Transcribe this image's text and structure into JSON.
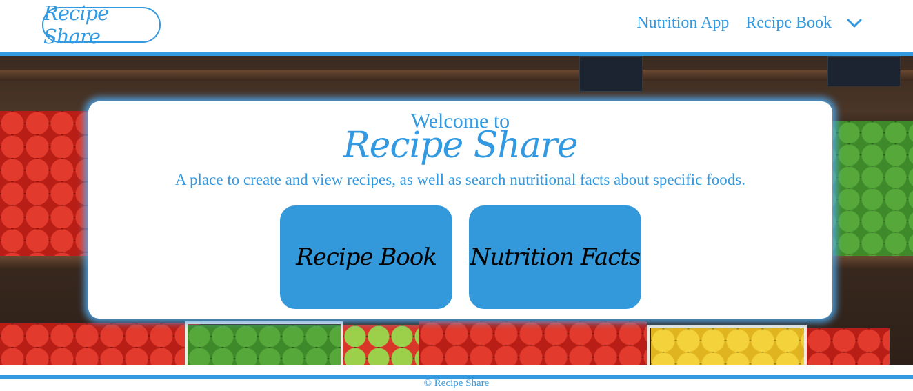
{
  "header": {
    "logo_text": "Recipe Share",
    "nav": [
      {
        "label": "Nutrition App"
      },
      {
        "label": "Recipe Book"
      }
    ],
    "dropdown_icon": "chevron-down-icon"
  },
  "hero": {
    "welcome": "Welcome to",
    "brand": "Recipe Share",
    "tagline": "A place to create and view recipes, as well as search nutritional facts about specific foods.",
    "buttons": [
      {
        "label": "Recipe Book"
      },
      {
        "label": "Nutrition Facts"
      }
    ]
  },
  "footer": {
    "text": "© Recipe Share"
  },
  "colors": {
    "accent": "#3399e0",
    "tile": "#3399db",
    "glow": "#50aaf0"
  }
}
